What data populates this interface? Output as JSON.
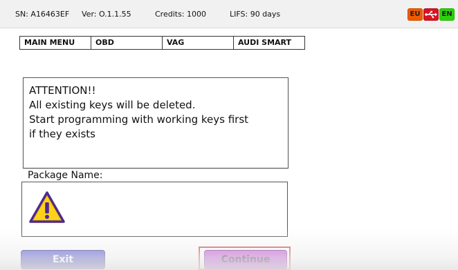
{
  "statusbar": {
    "serial": "SN: A16463EF",
    "version": "Ver: O.1.1.55",
    "credits": "Credits: 1000",
    "lifs": "LIFS: 90 days",
    "flags": {
      "region_label": "EU",
      "usb_icon": "usb-icon",
      "language_label": "EN"
    },
    "colors": {
      "eu": "#f05a00",
      "usb": "#d71324",
      "en": "#2bd10a"
    }
  },
  "breadcrumb": {
    "items": [
      {
        "label": "MAIN MENU"
      },
      {
        "label": "OBD"
      },
      {
        "label": "VAG"
      },
      {
        "label": "AUDI SMART"
      }
    ]
  },
  "attention": {
    "lines": [
      "ATTENTION!!",
      "All existing keys will be deleted.",
      "Start programming with working keys first",
      "if they exists"
    ]
  },
  "package": {
    "label": "Package Name:",
    "icon": "warning-icon"
  },
  "buttons": {
    "exit_label": "Exit",
    "continue_label": "Continue"
  },
  "colors": {
    "exit_button": "#2a2aa8",
    "continue_button": "#a92ec4",
    "highlight": "#d43a3a"
  }
}
